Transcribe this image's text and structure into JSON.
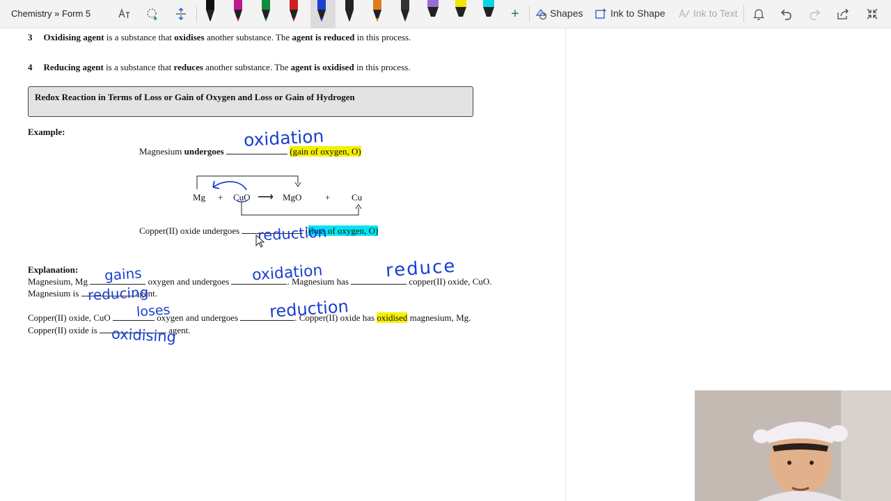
{
  "toolbar": {
    "breadcrumb": "Chemistry » Form 5",
    "pens": [
      {
        "name": "pen-black",
        "color": "#111111"
      },
      {
        "name": "pen-magenta",
        "color": "#c2188d"
      },
      {
        "name": "pen-green",
        "color": "#0e8a3a"
      },
      {
        "name": "pen-red",
        "color": "#d01f1f"
      },
      {
        "name": "pen-blue",
        "color": "#1a3fd1"
      },
      {
        "name": "pen-glitter-black",
        "color": "#222222"
      },
      {
        "name": "pen-rainbow",
        "color": "#e07b1a"
      },
      {
        "name": "pen-galaxy",
        "color": "#333333"
      },
      {
        "name": "highlighter-purple",
        "color": "#9c6bd8"
      },
      {
        "name": "highlighter-yellow",
        "color": "#f5e400"
      },
      {
        "name": "highlighter-cyan",
        "color": "#00d8e8"
      }
    ],
    "shapes_label": "Shapes",
    "ink_to_shape_label": "Ink to Shape",
    "ink_to_text_label": "Ink to Text"
  },
  "document": {
    "item3": {
      "num": "3",
      "t1": "Oxidising agent",
      "t2": " is a substance that ",
      "t3": "oxidises",
      "t4": " another substance. The ",
      "t5": "agent is reduced",
      "t6": " in this process."
    },
    "item4": {
      "num": "4",
      "t1": "Reducing agent",
      "t2": " is a substance that ",
      "t3": "reduces",
      "t4": " another substance. The ",
      "t5": "agent is oxidised",
      "t6": " in this process."
    },
    "section_title": "Redox Reaction in Terms of Loss or Gain of Oxygen and Loss or Gain of Hydrogen",
    "example_label": "Example:",
    "mg_line": {
      "a": "Magnesium ",
      "b": "undergoes",
      "c": "(gain of oxygen, O)"
    },
    "equation": {
      "mg": "Mg",
      "plus1": "+",
      "cuo": "CuO",
      "arrow": "⟶",
      "mgo": "MgO",
      "plus2": "+",
      "cu": "Cu"
    },
    "cu_line": {
      "a": "Copper(II) oxide undergoes",
      "c": "(loss of oxygen, O)"
    },
    "explanation_label": "Explanation:",
    "exp1": {
      "a": "Magnesium, Mg",
      "b": "oxygen and undergoes",
      "c": ". Magnesium has",
      "d": "copper(II) oxide, CuO."
    },
    "exp2": {
      "a": "Magnesium is",
      "b": "agent."
    },
    "exp3": {
      "a": "Copper(II) oxide, CuO",
      "b": "oxygen and undergoes",
      "c": ". Copper(II) oxide has",
      "d": "oxidised",
      "e": " magnesium, Mg."
    },
    "exp4": {
      "a": "Copper(II) oxide is",
      "b": "agent."
    }
  },
  "ink": {
    "oxidation_top": "oxidation",
    "reduction_mid": "reduction",
    "gains": "gains",
    "oxidation_exp": "oxidation",
    "reduce": "reduce",
    "reducing": "reducing",
    "loses": "loses",
    "reduction_exp": "reduction",
    "oxidising": "oxidising"
  }
}
